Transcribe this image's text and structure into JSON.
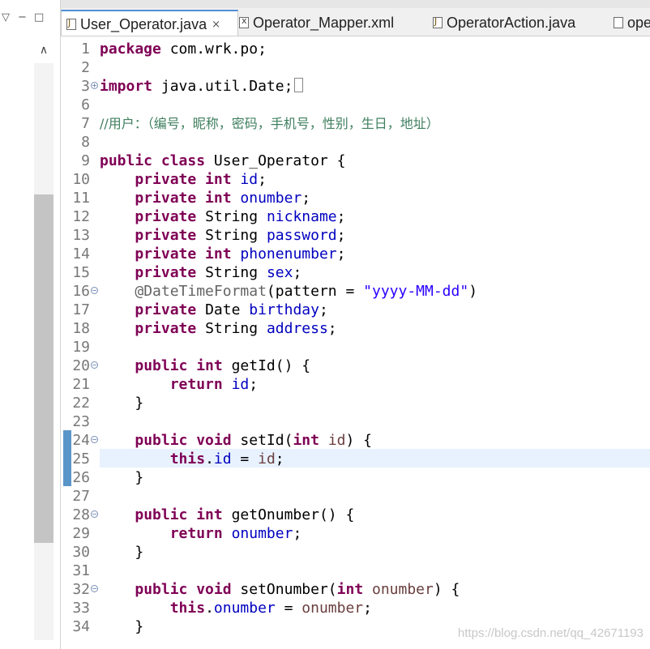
{
  "left_panel": {
    "collapse_glyph": "▽",
    "minimize_glyph": "−",
    "maximize_glyph": "□",
    "scroll_up_glyph": "∧"
  },
  "tabs": [
    {
      "label": "User_Operator.java",
      "icon": "java-file-icon",
      "active": true,
      "close": "×"
    },
    {
      "label": "Operator_Mapper.xml",
      "icon": "xml-file-icon",
      "active": false
    },
    {
      "label": "OperatorAction.java",
      "icon": "java-file-icon",
      "active": false
    },
    {
      "label": "ope",
      "icon": "file-icon",
      "active": false
    }
  ],
  "editor": {
    "current_line": 25,
    "lines": [
      {
        "n": "1",
        "fold": "",
        "tokens": [
          [
            "kw",
            "package"
          ],
          [
            "",
            "com.wrk.po;"
          ]
        ]
      },
      {
        "n": "2",
        "fold": "",
        "tokens": []
      },
      {
        "n": "3",
        "fold": "+",
        "tokens": [
          [
            "kw",
            "import"
          ],
          [
            "",
            "java.util.Date;"
          ],
          [
            "box",
            ""
          ]
        ]
      },
      {
        "n": "6",
        "fold": "",
        "tokens": []
      },
      {
        "n": "7",
        "fold": "",
        "tokens": [
          [
            "cmt",
            "//用户：（编号，昵称，密码，手机号，性别，生日，地址）"
          ]
        ]
      },
      {
        "n": "8",
        "fold": "",
        "tokens": []
      },
      {
        "n": "9",
        "fold": "",
        "tokens": [
          [
            "kw",
            "public class"
          ],
          [
            "",
            "User_Operator {"
          ]
        ]
      },
      {
        "n": "10",
        "fold": "",
        "tokens": [
          [
            "",
            "    "
          ],
          [
            "kw",
            "private int"
          ],
          [
            "fld",
            "id"
          ],
          [
            "",
            ";"
          ]
        ]
      },
      {
        "n": "11",
        "fold": "",
        "tokens": [
          [
            "",
            "    "
          ],
          [
            "kw",
            "private int"
          ],
          [
            "fld",
            "onumber"
          ],
          [
            "",
            ";"
          ]
        ]
      },
      {
        "n": "12",
        "fold": "",
        "tokens": [
          [
            "",
            "    "
          ],
          [
            "kw",
            "private"
          ],
          [
            "",
            "String"
          ],
          [
            "fld",
            "nickname"
          ],
          [
            "",
            ";"
          ]
        ]
      },
      {
        "n": "13",
        "fold": "",
        "tokens": [
          [
            "",
            "    "
          ],
          [
            "kw",
            "private"
          ],
          [
            "",
            "String"
          ],
          [
            "fld",
            "password"
          ],
          [
            "",
            ";"
          ]
        ]
      },
      {
        "n": "14",
        "fold": "",
        "tokens": [
          [
            "",
            "    "
          ],
          [
            "kw",
            "private int"
          ],
          [
            "fld",
            "phonenumber"
          ],
          [
            "",
            ";"
          ]
        ]
      },
      {
        "n": "15",
        "fold": "",
        "tokens": [
          [
            "",
            "    "
          ],
          [
            "kw",
            "private"
          ],
          [
            "",
            "String"
          ],
          [
            "fld",
            "sex"
          ],
          [
            "",
            ";"
          ]
        ]
      },
      {
        "n": "16",
        "fold": "−",
        "tokens": [
          [
            "",
            "    "
          ],
          [
            "ann",
            "@DateTimeFormat"
          ],
          [
            "",
            "(pattern = "
          ],
          [
            "str",
            "\"yyyy-MM-dd\""
          ],
          [
            "",
            ")"
          ]
        ]
      },
      {
        "n": "17",
        "fold": "",
        "tokens": [
          [
            "",
            "    "
          ],
          [
            "kw",
            "private"
          ],
          [
            "",
            "Date"
          ],
          [
            "fld",
            "birthday"
          ],
          [
            "",
            ";"
          ]
        ]
      },
      {
        "n": "18",
        "fold": "",
        "tokens": [
          [
            "",
            "    "
          ],
          [
            "kw",
            "private"
          ],
          [
            "",
            "String"
          ],
          [
            "fld",
            "address"
          ],
          [
            "",
            ";"
          ]
        ]
      },
      {
        "n": "19",
        "fold": "",
        "tokens": []
      },
      {
        "n": "20",
        "fold": "−",
        "tokens": [
          [
            "",
            "    "
          ],
          [
            "kw",
            "public int"
          ],
          [
            "",
            "getId() {"
          ]
        ]
      },
      {
        "n": "21",
        "fold": "",
        "tokens": [
          [
            "",
            "        "
          ],
          [
            "kw",
            "return"
          ],
          [
            "fld",
            "id"
          ],
          [
            "",
            ";"
          ]
        ]
      },
      {
        "n": "22",
        "fold": "",
        "tokens": [
          [
            "",
            "    }"
          ]
        ]
      },
      {
        "n": "23",
        "fold": "",
        "tokens": []
      },
      {
        "n": "24",
        "fold": "−",
        "tokens": [
          [
            "",
            "    "
          ],
          [
            "kw",
            "public void"
          ],
          [
            "",
            "setId("
          ],
          [
            "kw",
            "int"
          ],
          [
            "param",
            "id"
          ],
          [
            "",
            ") {"
          ]
        ]
      },
      {
        "n": "25",
        "fold": "",
        "tokens": [
          [
            "",
            "        "
          ],
          [
            "kw",
            "this"
          ],
          [
            "",
            "."
          ],
          [
            "fld",
            "id"
          ],
          [
            "",
            " = "
          ],
          [
            "param",
            "id"
          ],
          [
            "",
            ";"
          ]
        ]
      },
      {
        "n": "26",
        "fold": "",
        "tokens": [
          [
            "",
            "    }"
          ]
        ]
      },
      {
        "n": "27",
        "fold": "",
        "tokens": []
      },
      {
        "n": "28",
        "fold": "−",
        "tokens": [
          [
            "",
            "    "
          ],
          [
            "kw",
            "public int"
          ],
          [
            "",
            "getOnumber() {"
          ]
        ]
      },
      {
        "n": "29",
        "fold": "",
        "tokens": [
          [
            "",
            "        "
          ],
          [
            "kw",
            "return"
          ],
          [
            "fld",
            "onumber"
          ],
          [
            "",
            ";"
          ]
        ]
      },
      {
        "n": "30",
        "fold": "",
        "tokens": [
          [
            "",
            "    }"
          ]
        ]
      },
      {
        "n": "31",
        "fold": "",
        "tokens": []
      },
      {
        "n": "32",
        "fold": "−",
        "tokens": [
          [
            "",
            "    "
          ],
          [
            "kw",
            "public void"
          ],
          [
            "",
            "setOnumber("
          ],
          [
            "kw",
            "int"
          ],
          [
            "param",
            "onumber"
          ],
          [
            "",
            ") {"
          ]
        ]
      },
      {
        "n": "33",
        "fold": "",
        "tokens": [
          [
            "",
            "        "
          ],
          [
            "kw",
            "this"
          ],
          [
            "",
            "."
          ],
          [
            "fld",
            "onumber"
          ],
          [
            "",
            " = "
          ],
          [
            "param",
            "onumber"
          ],
          [
            "",
            ";"
          ]
        ]
      },
      {
        "n": "34",
        "fold": "",
        "tokens": [
          [
            "",
            "    }"
          ]
        ]
      }
    ]
  },
  "watermark": "https://blog.csdn.net/qq_42671193",
  "colors": {
    "keyword": "#7f0055",
    "field": "#0000c0",
    "string": "#2a00ff",
    "annotation": "#646464",
    "comment": "#3f7f5f",
    "parameter": "#6a3e3e",
    "current_line_highlight": "#e8f2fe",
    "active_tab_accent": "#4f8fd6"
  }
}
